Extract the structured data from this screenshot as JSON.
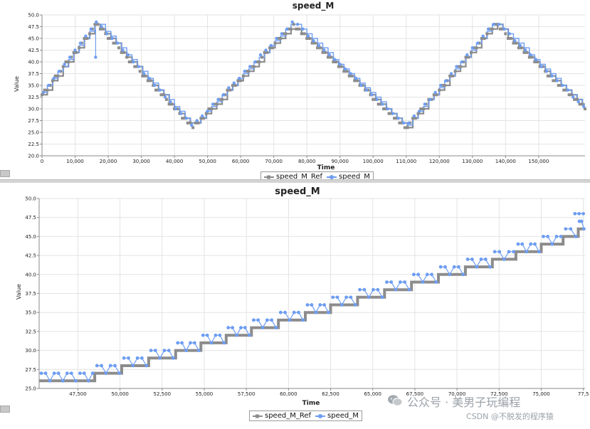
{
  "colors": {
    "ref": "#8c8c8c",
    "meas": "#6e9df2",
    "grid": "#e3e3e3",
    "axis": "#8a8a8a",
    "text": "#222222"
  },
  "top_legend": {
    "ref_label": "speed_M_Ref",
    "meas_label": "speed_M"
  },
  "bottom_legend": {
    "ref_label": "speed_M_Ref",
    "meas_label": "speed_M"
  },
  "watermark": {
    "line1": "公众号 · 美男子玩编程",
    "line2": "CSDN @不脱发的程序猿",
    "icon": "wechat-icon"
  },
  "chart_data": [
    {
      "type": "line",
      "title": "speed_M",
      "xlabel": "Time",
      "ylabel": "Value",
      "xlim": [
        0,
        164000
      ],
      "ylim": [
        20.0,
        50.0
      ],
      "x_ticks": [
        0,
        10000,
        20000,
        30000,
        40000,
        50000,
        60000,
        70000,
        80000,
        90000,
        100000,
        110000,
        120000,
        130000,
        140000,
        150000
      ],
      "x_tick_labels": [
        "0",
        "10,000",
        "20,000",
        "30,000",
        "40,000",
        "50,000",
        "60,000",
        "70,000",
        "80,000",
        "90,000",
        "100,000",
        "110,000",
        "120,000",
        "130,000",
        "140,000",
        "150,000"
      ],
      "y_ticks": [
        20.0,
        22.5,
        25.0,
        27.5,
        30.0,
        32.5,
        35.0,
        37.5,
        40.0,
        42.5,
        45.0,
        47.5,
        50.0
      ],
      "y_tick_labels": [
        "20.0",
        "22.5",
        "25.0",
        "27.5",
        "30.0",
        "32.5",
        "35.0",
        "37.5",
        "40.0",
        "42.5",
        "45.0",
        "47.5",
        "50.0"
      ],
      "grid": true,
      "legend": "bottom-center",
      "series": [
        {
          "name": "speed_M_Ref",
          "style": "step",
          "points": [
            [
              0,
              33
            ],
            [
              16500,
              48
            ],
            [
              45500,
              26
            ],
            [
              76000,
              48
            ],
            [
              110000,
              26
            ],
            [
              137000,
              48
            ],
            [
              164000,
              30
            ]
          ]
        },
        {
          "name": "speed_M",
          "style": "step-markers",
          "points": [
            [
              0,
              33.3
            ],
            [
              16500,
              48.6
            ],
            [
              45500,
              26.3
            ],
            [
              76000,
              48.6
            ],
            [
              110000,
              26.3
            ],
            [
              137000,
              48.6
            ],
            [
              164000,
              30.3
            ]
          ],
          "dip": {
            "x": 16200,
            "y": 41
          }
        }
      ]
    },
    {
      "type": "line",
      "title": "speed_M",
      "xlabel": "Time",
      "ylabel": "Value",
      "xlim": [
        45200,
        77600
      ],
      "ylim": [
        25.0,
        50.0
      ],
      "x_ticks": [
        47500,
        50000,
        52500,
        55000,
        57500,
        60000,
        62500,
        65000,
        67500,
        70000,
        72500,
        75000,
        77500
      ],
      "x_tick_labels": [
        "47,500",
        "50,000",
        "52,500",
        "55,000",
        "57,500",
        "60,000",
        "62,500",
        "65,000",
        "67,500",
        "70,000",
        "72,500",
        "75,000",
        "77,5"
      ],
      "y_ticks": [
        25.0,
        27.5,
        30.0,
        32.5,
        35.0,
        37.5,
        40.0,
        42.5,
        45.0,
        47.5,
        50.0
      ],
      "y_tick_labels": [
        "25.0",
        "27.5",
        "30.0",
        "32.5",
        "35.0",
        "37.5",
        "40.0",
        "42.5",
        "45.0",
        "47.5",
        "50.0"
      ],
      "grid": true,
      "legend": "bottom-center",
      "series": [
        {
          "name": "speed_M_Ref",
          "style": "step",
          "levels": [
            [
              45200,
              26
            ],
            [
              47500,
              26
            ],
            [
              48500,
              27
            ],
            [
              50100,
              28
            ],
            [
              51700,
              29
            ],
            [
              53300,
              30
            ],
            [
              54800,
              31
            ],
            [
              56300,
              32
            ],
            [
              57800,
              33
            ],
            [
              59400,
              34
            ],
            [
              61000,
              35
            ],
            [
              62500,
              36
            ],
            [
              64100,
              37
            ],
            [
              65700,
              38
            ],
            [
              67300,
              39
            ],
            [
              68900,
              40
            ],
            [
              70500,
              41
            ],
            [
              72100,
              42
            ],
            [
              73500,
              43
            ],
            [
              75000,
              44
            ],
            [
              76300,
              45
            ],
            [
              77200,
              46
            ]
          ]
        },
        {
          "name": "speed_M",
          "style": "step-markers",
          "offset": 1,
          "ends": [
            77000,
            48
          ]
        }
      ]
    }
  ]
}
